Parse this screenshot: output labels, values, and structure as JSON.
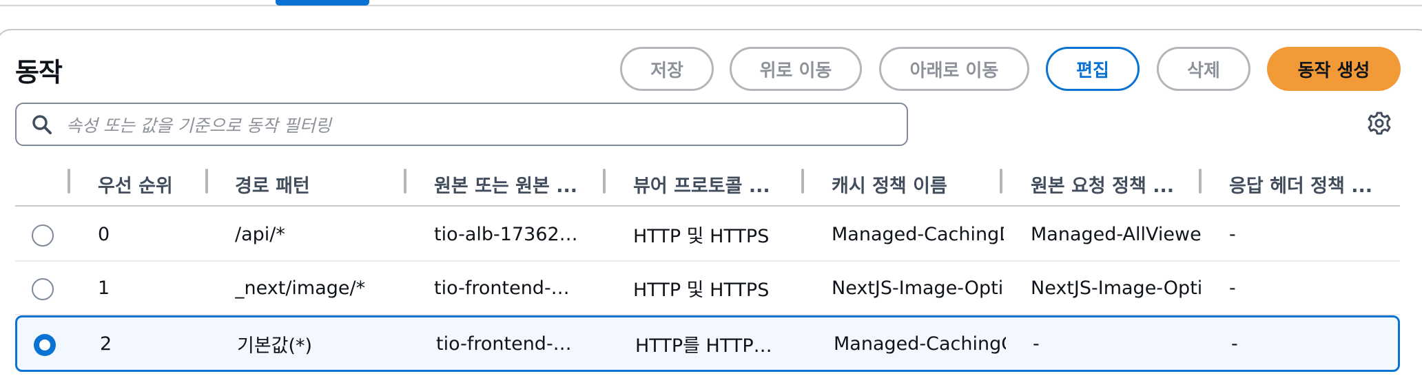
{
  "panel": {
    "title": "동작",
    "buttons": {
      "save": "저장",
      "move_up": "위로 이동",
      "move_down": "아래로 이동",
      "edit": "편집",
      "delete": "삭제",
      "create": "동작 생성"
    },
    "search": {
      "placeholder": "속성 또는 값을 기준으로 동작 필터링"
    }
  },
  "table": {
    "columns": [
      "우선 순위",
      "경로 패턴",
      "원본 또는 원본 ...",
      "뷰어 프로토콜 ...",
      "캐시 정책 이름",
      "원본 요청 정책 ...",
      "응답 헤더 정책 ..."
    ],
    "rows": [
      {
        "selected": false,
        "cells": [
          "0",
          "/api/*",
          "tio-alb-17362…",
          "HTTP 및 HTTPS",
          "Managed-CachingD",
          "Managed-AllViewer",
          "-"
        ]
      },
      {
        "selected": false,
        "cells": [
          "1",
          "_next/image/*",
          "tio-frontend-…",
          "HTTP 및 HTTPS",
          "NextJS-Image-Opti",
          "NextJS-Image-Opti",
          "-"
        ]
      },
      {
        "selected": true,
        "cells": [
          "2",
          "기본값(*)",
          "tio-frontend-…",
          "HTTP를 HTTP…",
          "Managed-CachingC",
          "-",
          "-"
        ]
      }
    ]
  },
  "icons": {
    "search": "search-icon",
    "settings": "gear-icon"
  },
  "colors": {
    "accent": "#0972d3",
    "primary_button": "#f29a38",
    "selected_row_bg": "#f2f8fd"
  }
}
